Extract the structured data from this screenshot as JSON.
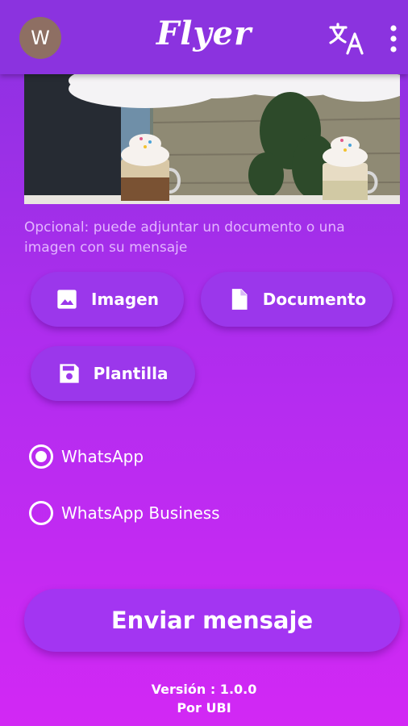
{
  "appbar": {
    "avatar_letter": "W",
    "logo_text": "Flyer",
    "color": "#8b33df"
  },
  "hero": {
    "description": ""
  },
  "hint_text": "Opcional: puede adjuntar un documento o una imagen con su mensaje",
  "attach_buttons": {
    "imagen_label": "Imagen",
    "documento_label": "Documento",
    "plantilla_label": "Plantilla"
  },
  "platform_options": [
    {
      "label": "WhatsApp",
      "selected": true
    },
    {
      "label": "WhatsApp Business",
      "selected": false
    }
  ],
  "send_button_label": "Enviar mensaje",
  "footer": {
    "version": "Versión : 1.0.0",
    "author": "Por UBI"
  },
  "colors": {
    "background_top": "#8a32e0",
    "background_bottom": "#d228f4",
    "button": "#9b37eb",
    "hint_text": "#e3b6ff"
  },
  "icons": [
    "translate-icon",
    "more-vert-icon",
    "image-icon",
    "document-icon",
    "save-icon"
  ]
}
